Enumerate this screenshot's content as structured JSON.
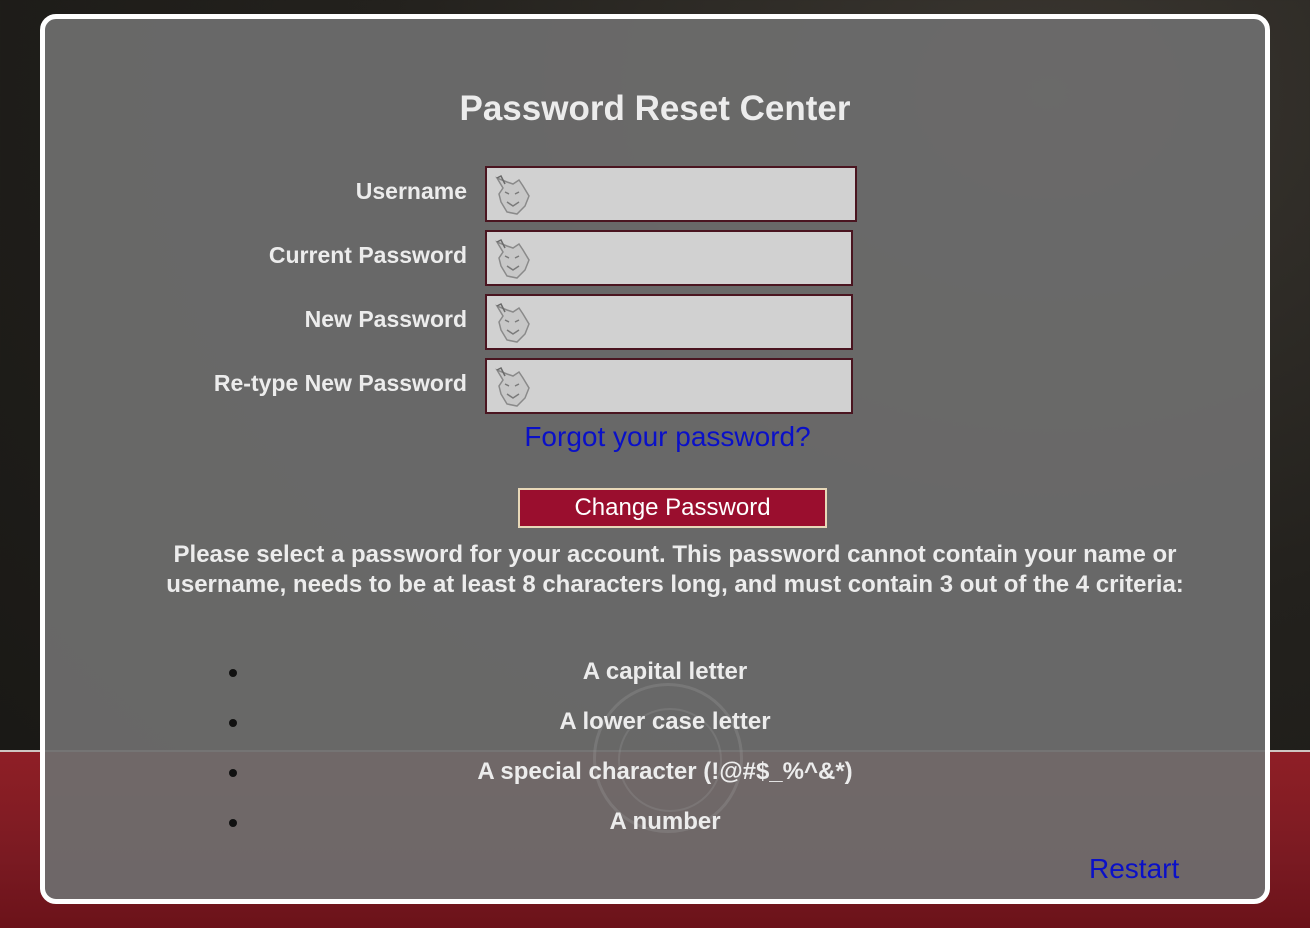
{
  "form": {
    "title": "Password Reset Center",
    "fields": [
      {
        "label": "Username",
        "value": "",
        "placeholder": ""
      },
      {
        "label": "Current Password",
        "value": "",
        "placeholder": ""
      },
      {
        "label": "New Password",
        "value": "",
        "placeholder": ""
      },
      {
        "label": "Re-type New Password",
        "value": "",
        "placeholder": ""
      }
    ],
    "forgot_link": "Forgot your password?",
    "submit_label": "Change Password"
  },
  "instructions": {
    "text": "Please select a password for your account. This password cannot contain your name or username, needs to be at least 8 characters long, and must contain 3 out of the 4 criteria:",
    "criteria": [
      "A capital letter",
      "A lower case letter",
      "A special character (!@#$_%^&*)",
      "A number"
    ]
  },
  "footer": {
    "restart_label": "Restart"
  },
  "colors": {
    "button_bg": "#9a0e2e",
    "link": "#0a10c8",
    "field_bg": "#d1d1d1",
    "panel_bg": "#6e6e6e"
  },
  "icons": {
    "field_icon": "wolf-head-icon"
  }
}
